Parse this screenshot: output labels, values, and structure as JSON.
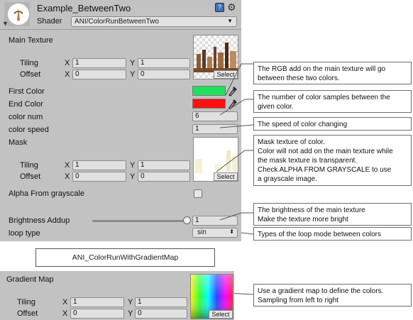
{
  "header": {
    "object_name": "Example_BetweenTwo",
    "shader_label": "Shader",
    "shader_value": "ANI/ColorRunBetweenTwo"
  },
  "main_texture": {
    "label": "Main Texture",
    "tiling_label": "Tiling",
    "offset_label": "Offset",
    "x_label": "X",
    "y_label": "Y",
    "tiling_x": "1",
    "tiling_y": "1",
    "offset_x": "0",
    "offset_y": "0",
    "select_label": "Select"
  },
  "first_color": {
    "label": "First Color",
    "color": "#1ee05a"
  },
  "end_color": {
    "label": "End Color",
    "color": "#ff1010"
  },
  "color_num": {
    "label": "color num",
    "value": "6"
  },
  "color_speed": {
    "label": "color speed",
    "value": "1"
  },
  "mask": {
    "label": "Mask",
    "tiling_label": "Tiling",
    "offset_label": "Offset",
    "x_label": "X",
    "y_label": "Y",
    "tiling_x": "1",
    "tiling_y": "1",
    "offset_x": "0",
    "offset_y": "0",
    "select_label": "Select"
  },
  "alpha_from_grayscale": {
    "label": "Alpha From grayscale",
    "checked": false
  },
  "brightness": {
    "label": "Brightness Addup",
    "value": "1",
    "slider_fraction": 1.0
  },
  "loop_type": {
    "label": "loop type",
    "value": "sin"
  },
  "callouts": {
    "rgb_add": [
      "The RGB add on the main texture will go",
      "between these two colors."
    ],
    "color_num": [
      "The number of color samples between the",
      "given color."
    ],
    "color_speed": [
      "The speed of color changing"
    ],
    "mask": [
      "Mask texture of color.",
      "Color will not add on the main texture while",
      "the mask texture is transparent.",
      "Check ALPHA FROM GRAYSCALE to use",
      "a grayscale image."
    ],
    "brightness": [
      "The brightness of the main texture",
      "Make the texture more bright"
    ],
    "loop_type": [
      "Types of the loop mode between colors"
    ],
    "gradient": [
      "Use a gradient map to define the colors.",
      "Sampling from left to right"
    ]
  },
  "section_title": "ANI_ColorRunWithGradientMap",
  "gradient_map": {
    "label": "Gradient Map",
    "tiling_label": "Tiling",
    "offset_label": "Offset",
    "x_label": "X",
    "y_label": "Y",
    "tiling_x": "1",
    "tiling_y": "1",
    "offset_x": "0",
    "offset_y": "0",
    "select_label": "Select"
  },
  "icons": {
    "help": "help-book-icon",
    "settings": "gear-icon",
    "eyedropper": "eyedropper-icon"
  }
}
